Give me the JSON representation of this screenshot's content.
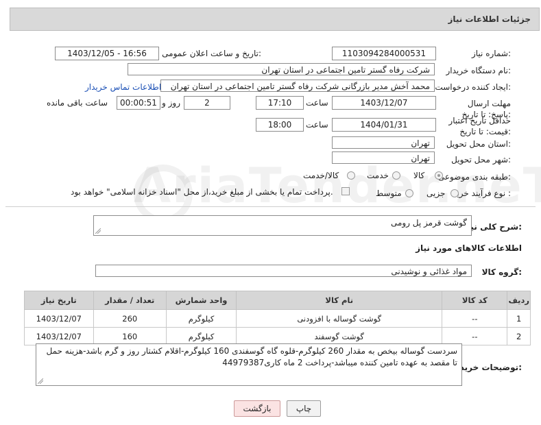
{
  "header": {
    "title": "جزئیات اطلاعات نیاز"
  },
  "fields": {
    "need_number_label": "شماره نیاز:",
    "need_number": "1103094284000531",
    "announce_label": "تاریخ و ساعت اعلان عمومی:",
    "announce_value": "1403/12/05 - 16:56",
    "buyer_org_label": "نام دستگاه خریدار:",
    "buyer_org": "شرکت رفاه گستر تامین اجتماعی در استان تهران",
    "creator_label": "ایجاد کننده درخواست:",
    "creator": "محمد آخش مدیر بازرگانی شرکت رفاه گستر تامین اجتماعی در استان تهران",
    "buyer_contact_link": "اطلاعات تماس خریدار",
    "reply_deadline_label": "مهلت ارسال پاسخ: تا تاریخ:",
    "reply_date": "1403/12/07",
    "time_label": "ساعت",
    "reply_time": "17:10",
    "days_value": "2",
    "days_label": "روز و",
    "remaining_time": "00:00:51",
    "remaining_label": "ساعت باقی مانده",
    "price_validity_label": "حداقل تاریخ اعتبار قیمت: تا تاریخ:",
    "price_date": "1404/01/31",
    "price_time": "18:00",
    "province_label": "استان محل تحویل:",
    "province": "تهران",
    "city_label": "شهر محل تحویل:",
    "city": "تهران",
    "category_label": "طبقه بندی موضوعی:",
    "category_options": [
      "کالا",
      "خدمت",
      "کالا/خدمت"
    ],
    "purchase_type_label": "نوع فرآیند خرید :",
    "purchase_options": [
      "جزیی",
      "متوسط"
    ],
    "payment_note": "پرداخت تمام یا بخشی از مبلغ خرید،از محل \"اسناد خزانه اسلامی\" خواهد بود."
  },
  "summary": {
    "label": "شرح کلی نیاز:",
    "value": "گوشت قرمز پل رومی"
  },
  "goods_section_title": "اطلاعات کالاهای مورد نیاز",
  "goods_group": {
    "label": "گروه کالا:",
    "value": "مواد غذائی و نوشیدنی"
  },
  "table": {
    "headers": [
      "ردیف",
      "کد کالا",
      "نام کالا",
      "واحد شمارش",
      "تعداد / مقدار",
      "تاریخ نیاز"
    ],
    "rows": [
      [
        "1",
        "--",
        "گوشت گوساله با افزودنی",
        "کیلوگرم",
        "260",
        "1403/12/07"
      ],
      [
        "2",
        "--",
        "گوشت گوسفند",
        "کیلوگرم",
        "160",
        "1403/12/07"
      ]
    ]
  },
  "buyer_notes": {
    "label": "توضیحات خریدار:",
    "value": "سردست گوساله بیخص به مقدار 260 کیلوگرم-قلوه گاه گوسفندی 160 کیلوگرم-اقلام کشتار روز و گرم باشد-هزینه حمل تا مقصد به عهده تامین کننده میباشد-پرداخت 2 ماه کاری44979387"
  },
  "buttons": {
    "print": "چاپ",
    "back": "بازگشت"
  },
  "watermark": "AriaTender.neT",
  "colors": {
    "link": "#1a4fb5",
    "back_button_bg": "#fbe3e3",
    "header_bg": "#d9d9d9"
  }
}
